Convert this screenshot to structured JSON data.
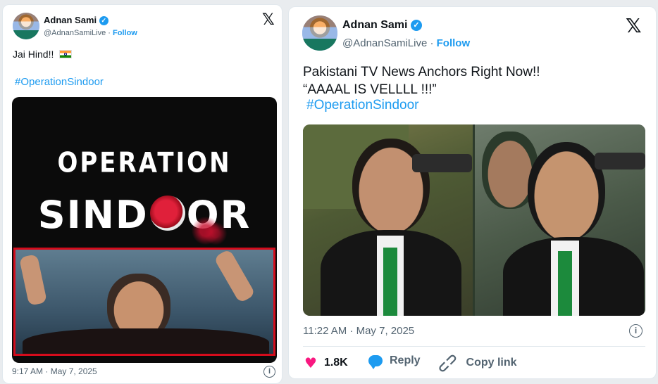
{
  "tweet1": {
    "author_name": "Adnan Sami",
    "handle": "@AdnanSamiLive",
    "separator": "·",
    "follow_label": "Follow",
    "text": "Jai Hind!!",
    "flag_emoji": "🇮🇳",
    "hashtag": "#OperationSindoor",
    "poster_line1": "OPERATION",
    "poster_line2_a": "SIND",
    "poster_line2_b": "OR",
    "timestamp": "9:17 AM · May 7, 2025"
  },
  "tweet2": {
    "author_name": "Adnan Sami",
    "handle": "@AdnanSamiLive",
    "separator": "·",
    "follow_label": "Follow",
    "text_line1": "Pakistani TV News Anchors Right Now!!",
    "text_line2": "“AAAAL IS VELLLL !!!”",
    "hashtag": "#OperationSindoor",
    "timestamp": "11:22 AM · May 7, 2025",
    "actions": {
      "likes": "1.8K",
      "reply_label": "Reply",
      "copy_label": "Copy link"
    }
  },
  "icons": [
    "verified-badge-icon",
    "x-logo-icon",
    "info-icon",
    "heart-icon",
    "reply-icon",
    "link-icon",
    "indian-flag-icon"
  ],
  "colors": {
    "accent": "#1d9bf0",
    "like": "#f91880",
    "poster_red": "#c8102e",
    "secondary_text": "#536471"
  }
}
